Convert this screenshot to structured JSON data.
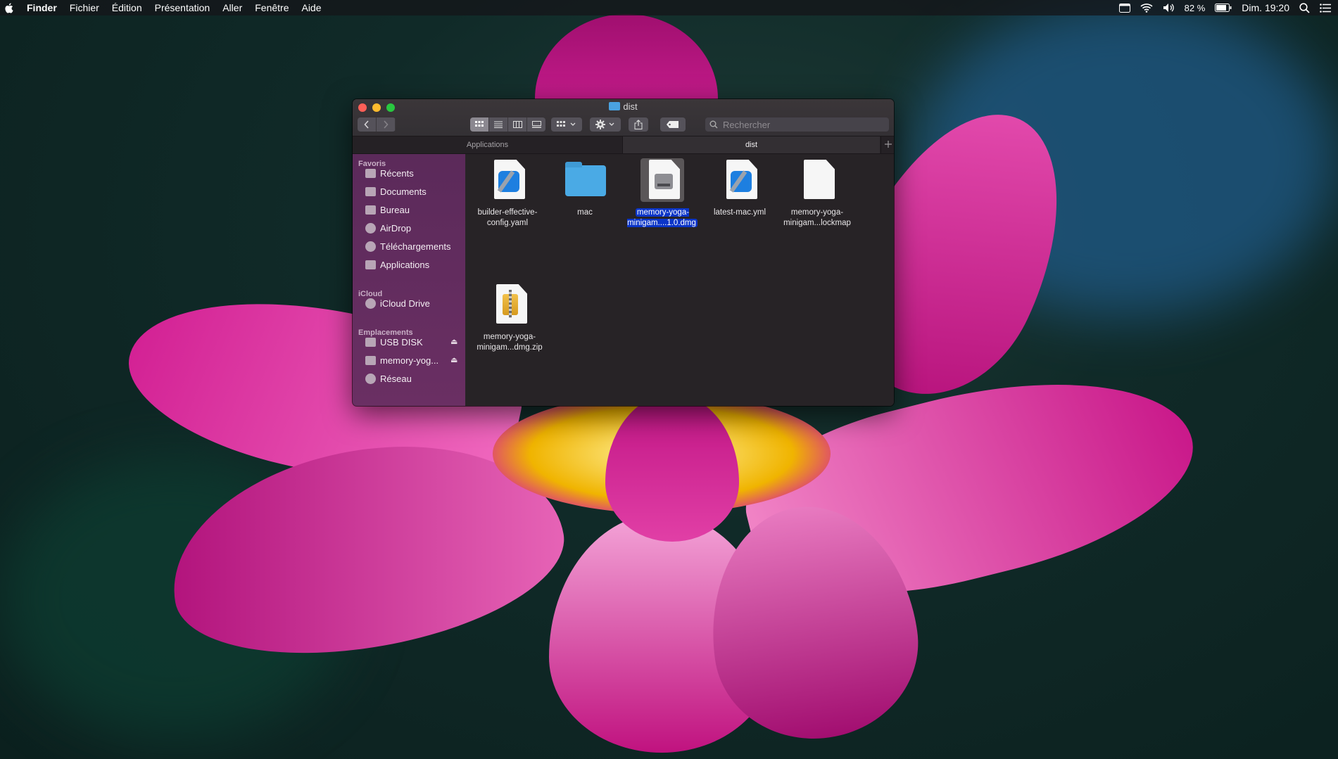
{
  "menubar": {
    "app_name": "Finder",
    "items": [
      "Fichier",
      "Édition",
      "Présentation",
      "Aller",
      "Fenêtre",
      "Aide"
    ],
    "battery": "82 %",
    "clock": "Dim. 19:20"
  },
  "window": {
    "title": "dist",
    "search_placeholder": "Rechercher",
    "tabs": [
      {
        "label": "Applications",
        "active": false
      },
      {
        "label": "dist",
        "active": true
      }
    ]
  },
  "sidebar": {
    "favoris_header": "Favoris",
    "favoris": [
      "Récents",
      "Documents",
      "Bureau",
      "AirDrop",
      "Téléchargements",
      "Applications"
    ],
    "icloud_header": "iCloud",
    "icloud": [
      "iCloud Drive"
    ],
    "emplacements_header": "Emplacements",
    "emplacements": [
      "USB DISK",
      "memory-yog...",
      "Réseau"
    ]
  },
  "files": [
    {
      "name": "builder-effective-\nconfig.yaml",
      "icon": "xcode-document-icon",
      "selected": false
    },
    {
      "name": "mac",
      "icon": "folder-icon",
      "selected": false
    },
    {
      "name": "memory-yoga-\nminigam....1.0.dmg",
      "icon": "disk-image-icon",
      "selected": true
    },
    {
      "name": "latest-mac.yml",
      "icon": "xcode-document-icon",
      "selected": false
    },
    {
      "name": "memory-yoga-\nminigam...lockmap",
      "icon": "blank-document-icon",
      "selected": false
    },
    {
      "name": "memory-yoga-\nminigam...dmg.zip",
      "icon": "zip-archive-icon",
      "selected": false
    }
  ],
  "colors": {
    "sidebar": "#63295f",
    "selection": "#0b35c8",
    "folder": "#4aaae5",
    "petal": "#d4168f"
  }
}
